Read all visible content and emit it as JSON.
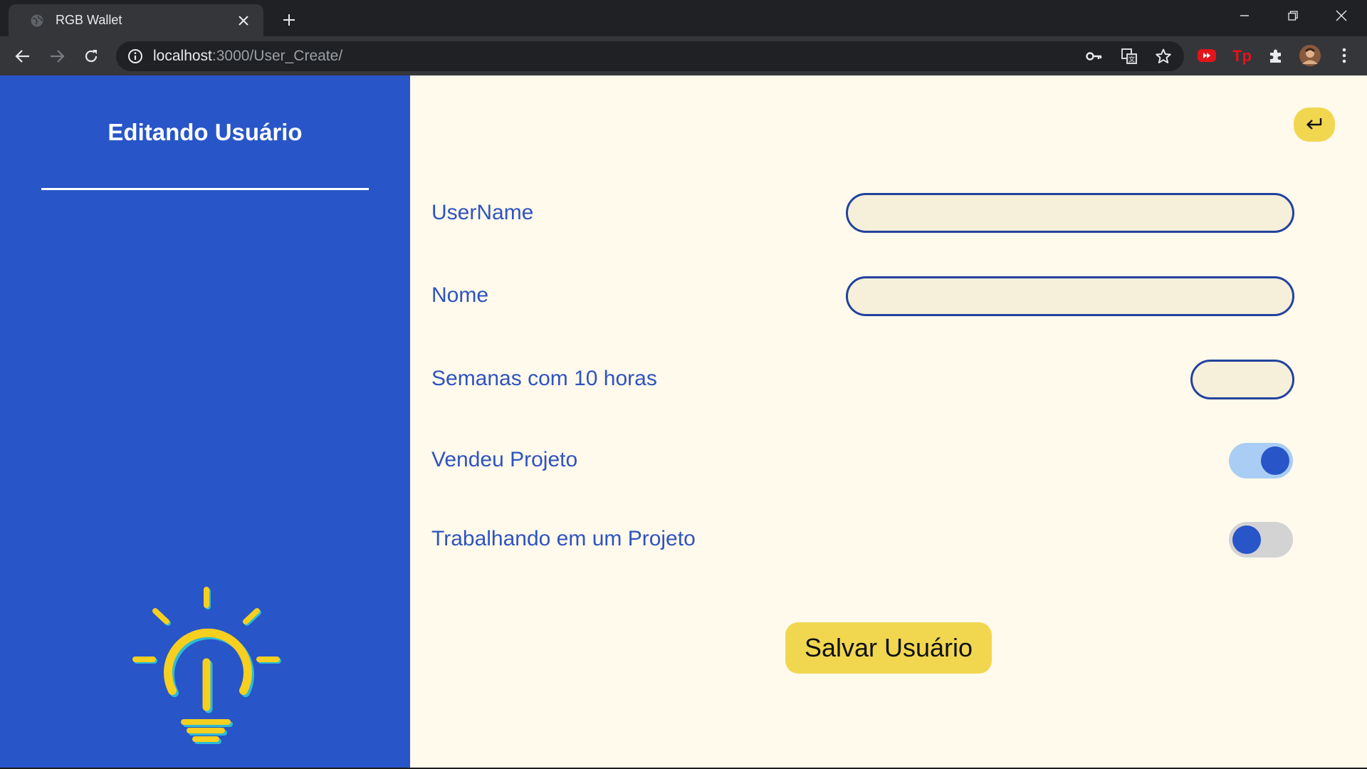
{
  "browser": {
    "tab_title": "RGB Wallet",
    "url_host": "localhost",
    "url_path": ":3000/User_Create/"
  },
  "sidebar": {
    "title": "Editando Usuário"
  },
  "form": {
    "username": {
      "label": "UserName",
      "value": ""
    },
    "nome": {
      "label": "Nome",
      "value": ""
    },
    "semanas": {
      "label": "Semanas com 10 horas",
      "value": ""
    },
    "vendeu_projeto": {
      "label": "Vendeu Projeto",
      "checked": true
    },
    "trabalhando_projeto": {
      "label": "Trabalhando em um Projeto",
      "checked": false
    },
    "save_label": "Salvar Usuário"
  },
  "colors": {
    "sidebar_bg": "#2855c8",
    "main_bg": "#fffaec",
    "accent_yellow": "#f1d750",
    "label_blue": "#2f53c0",
    "input_border": "#22429e",
    "toggle_on_track": "#a9cdf4",
    "toggle_off_track": "#d3d3d3"
  },
  "icons": {
    "back": "return-arrow-icon",
    "logo": "lightbulb-icon"
  }
}
